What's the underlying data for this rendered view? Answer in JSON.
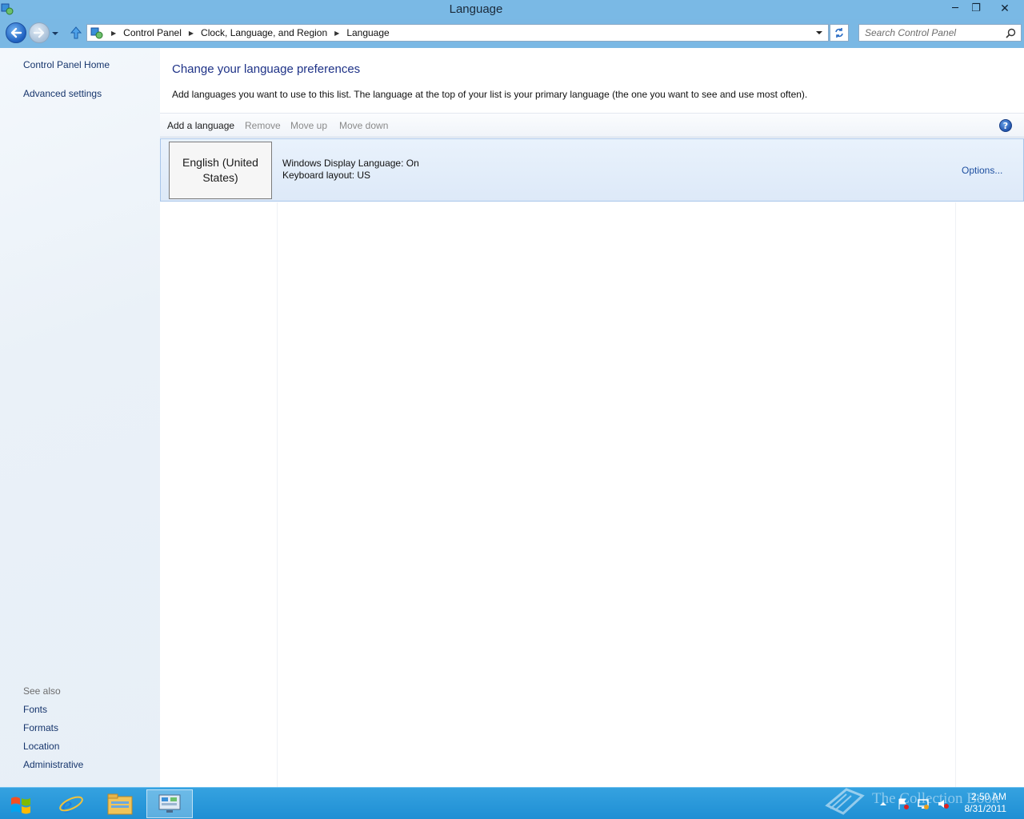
{
  "window": {
    "title": "Language",
    "minimize_label": "─",
    "maximize_label": "❐",
    "close_label": "✕"
  },
  "navbar": {
    "breadcrumbs": [
      "Control Panel",
      "Clock, Language, and Region",
      "Language"
    ],
    "search_placeholder": "Search Control Panel"
  },
  "sidebar": {
    "links": [
      {
        "label": "Control Panel Home"
      },
      {
        "label": "Advanced settings"
      }
    ],
    "see_also_label": "See also",
    "see_also": [
      {
        "label": "Fonts"
      },
      {
        "label": "Formats"
      },
      {
        "label": "Location"
      },
      {
        "label": "Administrative"
      }
    ]
  },
  "main": {
    "title": "Change your language preferences",
    "description": "Add languages you want to use to this list. The language at the top of your list is your primary language (the one you want to see and use most often).",
    "toolbar": {
      "add": "Add a language",
      "remove": "Remove",
      "move_up": "Move up",
      "move_down": "Move down",
      "help": "?"
    },
    "languages": [
      {
        "name": "English (United States)",
        "display_language": "Windows Display Language: On",
        "keyboard_layout": "Keyboard layout: US",
        "options_label": "Options..."
      }
    ]
  },
  "taskbar": {
    "clock_time": "2:50 AM",
    "clock_date": "8/31/2011",
    "watermark": "The Collection Book",
    "apps": [
      "internet-explorer",
      "file-explorer",
      "control-panel"
    ]
  },
  "colors": {
    "titlebar": "#7ab9e5",
    "link": "#16356c",
    "heading": "#1e3287",
    "taskbar": "#2a98da"
  }
}
